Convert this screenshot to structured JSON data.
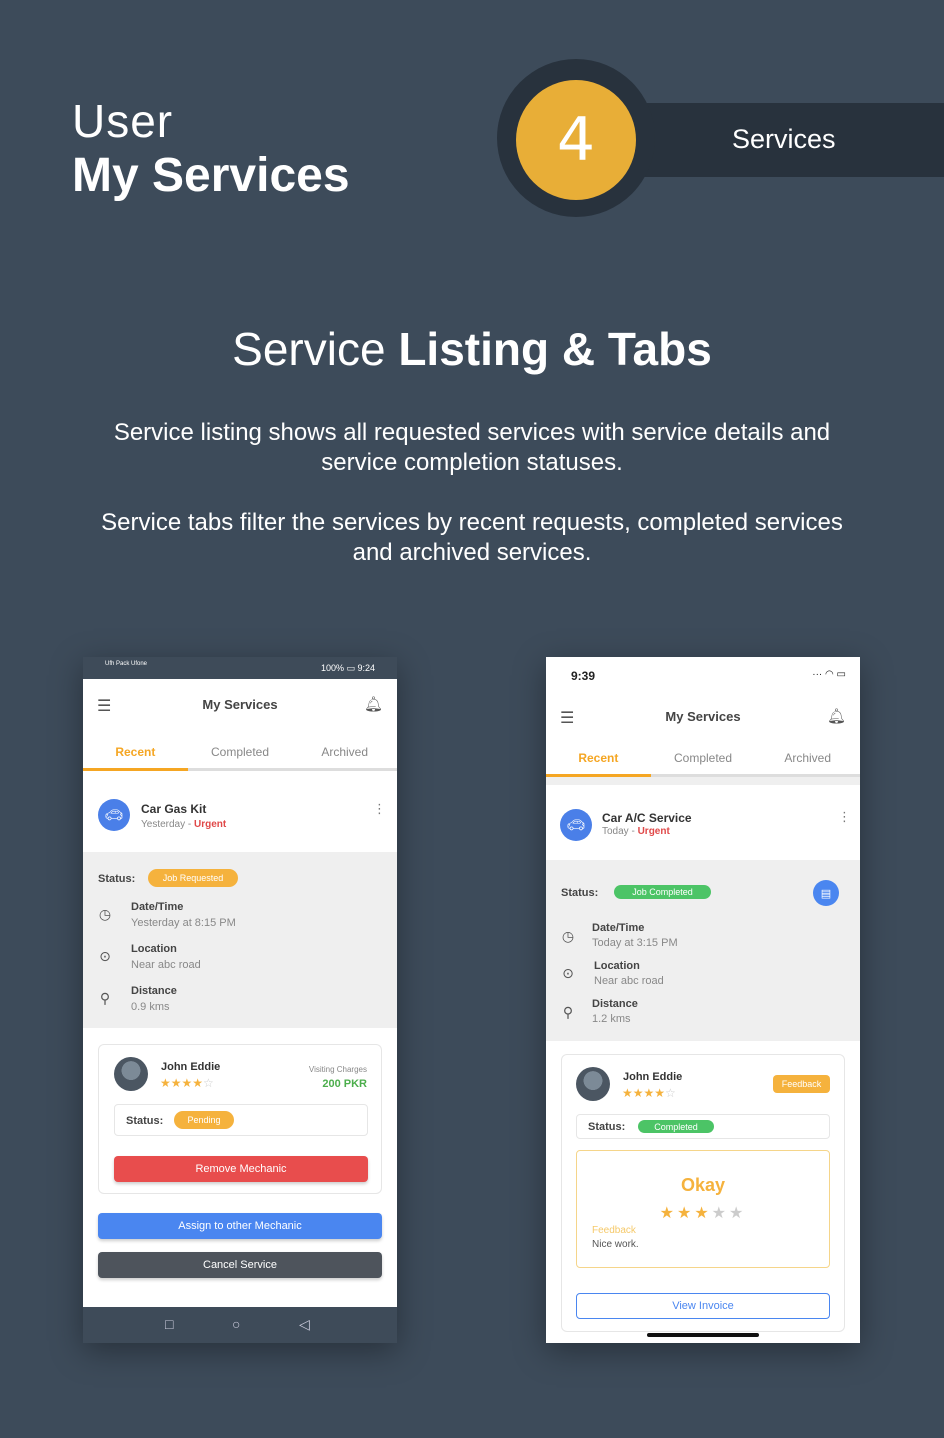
{
  "header": {
    "user": "User",
    "title": "My Services",
    "badge_number": "4",
    "badge_label": "Services"
  },
  "section": {
    "title_light": "Service",
    "title_bold": "Listing & Tabs",
    "desc1": "Service listing shows all requested services with service details and service completion statuses.",
    "desc2": "Service tabs filter the services by recent requests, completed services and archived services."
  },
  "colors": {
    "background": "#3d4b5a",
    "badge": "#e8ae37",
    "accent": "#f5a623"
  },
  "phone1": {
    "statusbar_left": "Ufh Pack Ufone",
    "statusbar_right": "100% ▭ 9:24",
    "app_title": "My Services",
    "tabs": [
      "Recent",
      "Completed",
      "Archived"
    ],
    "service": {
      "name": "Car Gas Kit",
      "when": "Yesterday - ",
      "priority": "Urgent"
    },
    "status_label": "Status:",
    "status_value": "Job Requested",
    "datetime_label": "Date/Time",
    "datetime_value": "Yesterday at 8:15 PM",
    "location_label": "Location",
    "location_value": "Near abc road",
    "distance_label": "Distance",
    "distance_value": "0.9 kms",
    "mechanic": {
      "name": "John Eddie",
      "rating": 4,
      "visiting_label": "Visiting Charges",
      "visiting_value": "200 PKR",
      "status_label": "Status:",
      "status_value": "Pending"
    },
    "buttons": {
      "remove": "Remove Mechanic",
      "assign": "Assign to other Mechanic",
      "cancel": "Cancel Service"
    }
  },
  "phone2": {
    "statusbar_time": "9:39",
    "app_title": "My Services",
    "tabs": [
      "Recent",
      "Completed",
      "Archived"
    ],
    "service": {
      "name": "Car A/C Service",
      "when": "Today - ",
      "priority": "Urgent"
    },
    "status_label": "Status:",
    "status_value": "Job Completed",
    "datetime_label": "Date/Time",
    "datetime_value": "Today at 3:15 PM",
    "location_label": "Location",
    "location_value": "Near abc road",
    "distance_label": "Distance",
    "distance_value": "1.2 kms",
    "mechanic": {
      "name": "John Eddie",
      "rating": 4,
      "feedback_button": "Feedback",
      "status_label": "Status:",
      "status_value": "Completed"
    },
    "feedback": {
      "headline": "Okay",
      "rating": 3,
      "label": "Feedback",
      "text": "Nice work."
    },
    "invoice_button": "View Invoice"
  }
}
